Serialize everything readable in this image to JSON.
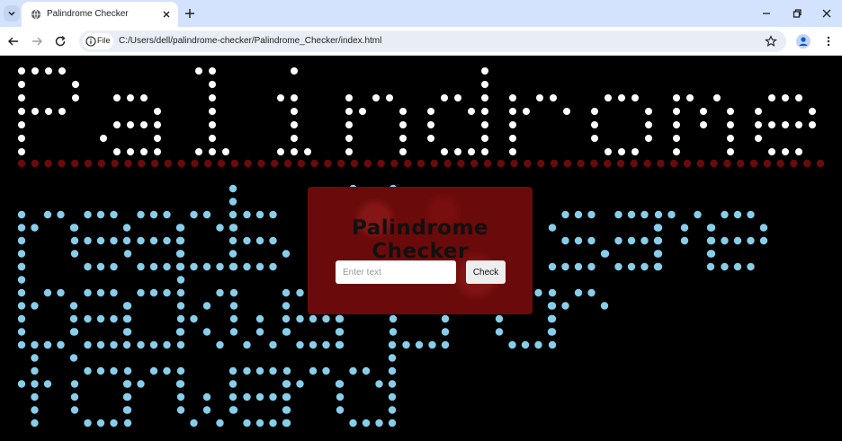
{
  "browser": {
    "tab_title": "Palindrome Checker",
    "url": "C:/Users/dell/palindrome-checker/Palindrome_Checker/index.html",
    "security_chip": "File"
  },
  "page": {
    "background_text": {
      "heading": "Palindrome",
      "body_lines": [
        "reads the same",
        "backward or",
        "forward"
      ],
      "heading_color": "#ffffff",
      "divider_color": "#6b0a0a",
      "body_color": "#87ceeb"
    },
    "dialog": {
      "title": "Palindrome Checker",
      "input_placeholder": "Enter text",
      "input_value": "",
      "button_label": "Check"
    }
  }
}
